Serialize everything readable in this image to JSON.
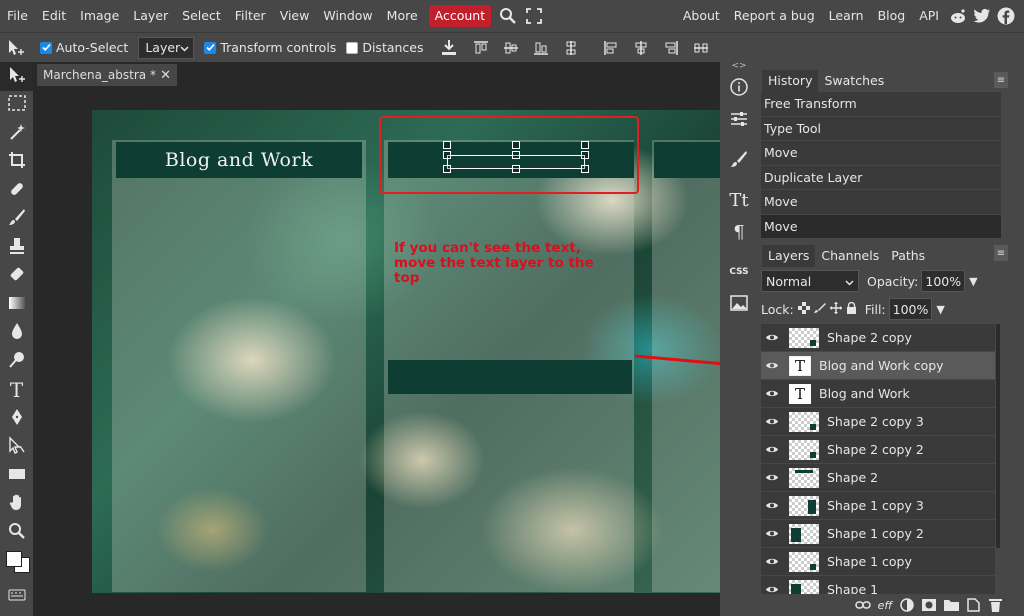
{
  "menu": {
    "items": [
      "File",
      "Edit",
      "Image",
      "Layer",
      "Select",
      "Filter",
      "View",
      "Window",
      "More"
    ],
    "account": "Account",
    "right": [
      "About",
      "Report a bug",
      "Learn",
      "Blog",
      "API"
    ]
  },
  "options": {
    "auto_select": "Auto-Select",
    "layer_select": "Layer",
    "transform_controls": "Transform controls",
    "distances": "Distances"
  },
  "document": {
    "tab_title": "Marchena_abstra *",
    "title_text": "Blog and Work",
    "annotation": "If you can't see the text, move the text layer to the top"
  },
  "history": {
    "tabs": [
      "History",
      "Swatches"
    ],
    "items": [
      "Free Transform",
      "Type Tool",
      "Move",
      "Duplicate Layer",
      "Move",
      "Move"
    ]
  },
  "layers_panel": {
    "tabs": [
      "Layers",
      "Channels",
      "Paths"
    ],
    "blend_mode": "Normal",
    "opacity_label": "Opacity:",
    "opacity_value": "100%",
    "lock_label": "Lock:",
    "fill_label": "Fill:",
    "fill_value": "100%",
    "layers": [
      {
        "name": "Shape 2 copy",
        "type": "shape"
      },
      {
        "name": "Blog and Work copy",
        "type": "text",
        "selected": true
      },
      {
        "name": "Blog and Work",
        "type": "text"
      },
      {
        "name": "Shape 2 copy 3",
        "type": "shape"
      },
      {
        "name": "Shape 2 copy 2",
        "type": "shape"
      },
      {
        "name": "Shape 2",
        "type": "shape"
      },
      {
        "name": "Shape 1 copy 3",
        "type": "shape"
      },
      {
        "name": "Shape 1 copy 2",
        "type": "shape"
      },
      {
        "name": "Shape 1 copy",
        "type": "shape"
      },
      {
        "name": "Shape 1",
        "type": "shape"
      }
    ],
    "bottom_eff": "eff"
  },
  "colors": {
    "accent": "#c11f2b",
    "checkbox": "#1e88e5",
    "annotation": "#d80f1e",
    "dark_green": "#0d3d33"
  }
}
